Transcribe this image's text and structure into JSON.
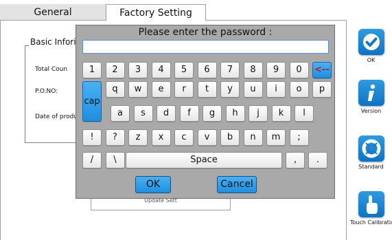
{
  "tabs": {
    "general": "General",
    "factory_setting": "Factory Setting"
  },
  "background": {
    "group_title": "Basic Infori",
    "total_count_label": "Total Coun",
    "po_no_label": "P.O.NO:",
    "date_label": "Date of produ",
    "update_button": "Update Sett"
  },
  "sidebar": {
    "ok": {
      "label": "OK",
      "icon": "check-icon"
    },
    "version": {
      "label": "Version",
      "icon": "info-icon"
    },
    "standard": {
      "label": "Standard",
      "icon": "lifebuoy-icon"
    },
    "touch_calibration": {
      "label": "Touch Calibration",
      "icon": "pointing-hand-icon"
    }
  },
  "dialog": {
    "title": "Please enter the password :",
    "password_value": "",
    "keyboard": {
      "row1": [
        "1",
        "2",
        "3",
        "4",
        "5",
        "6",
        "7",
        "8",
        "9",
        "0"
      ],
      "backspace": "<--",
      "cap": "cap",
      "row2": [
        "q",
        "w",
        "e",
        "r",
        "t",
        "y",
        "u",
        "i",
        "o",
        "p"
      ],
      "row3": [
        "a",
        "s",
        "d",
        "f",
        "g",
        "h",
        "j",
        "k",
        "l"
      ],
      "row4": [
        "!",
        "?",
        "z",
        "x",
        "c",
        "v",
        "b",
        "n",
        "m",
        ";"
      ],
      "row5_left": [
        "/",
        "\\"
      ],
      "space": "Space",
      "row5_right": [
        ",",
        "."
      ]
    },
    "ok_button": "OK",
    "cancel_button": "Cancel"
  },
  "colors": {
    "accent_blue": "#1e8fe0",
    "dialog_gray": "#a9a9a9",
    "backspace_red": "#c0172b"
  }
}
